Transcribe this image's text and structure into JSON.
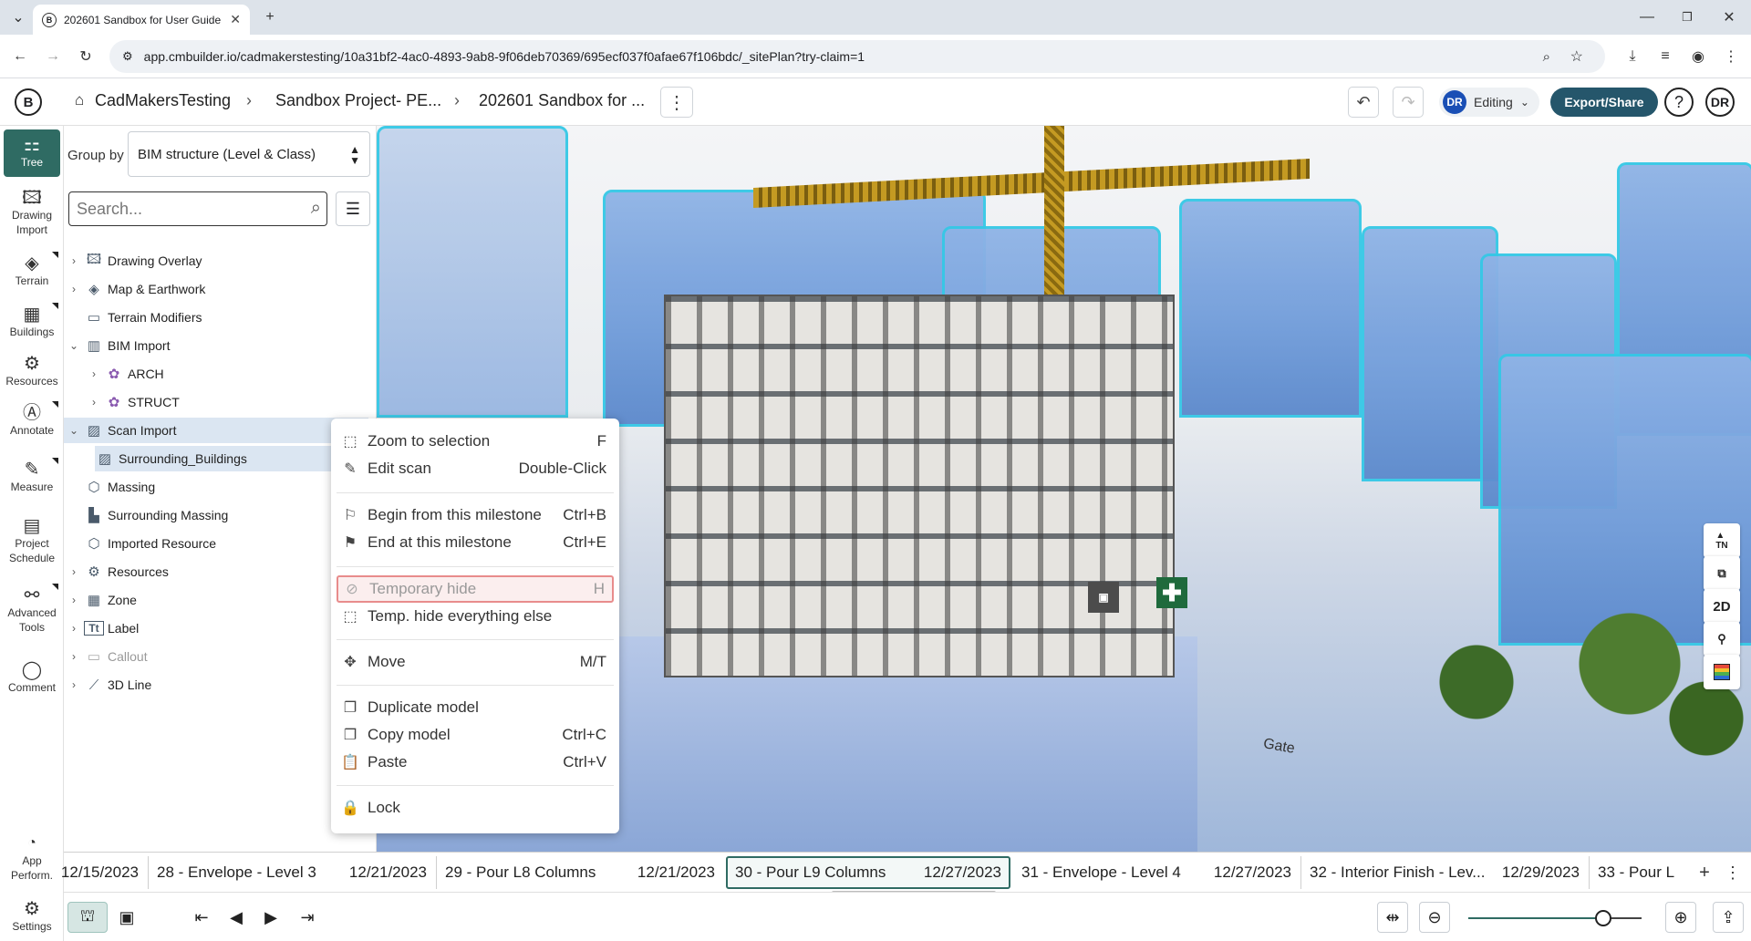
{
  "browser": {
    "tab_title": "202601 Sandbox for User Guide",
    "tab_favicon": "B",
    "url": "app.cmbuilder.io/cadmakerstesting/10a31bf2-4ac0-4893-9ab8-9f06deb70369/695ecf037f0afae67f106bdc/_sitePlan?try-claim=1"
  },
  "header": {
    "logo": "B",
    "breadcrumbs": [
      "CadMakersTesting",
      "Sandbox Project- PE...",
      "202601 Sandbox for ..."
    ],
    "mode": "Editing",
    "user_initials": "DR",
    "export_label": "Export/Share",
    "help": "?"
  },
  "rail": {
    "items": [
      {
        "label": "Tree",
        "icon": "tree-icon"
      },
      {
        "label": "Drawing Import",
        "icon": "drawing-import-icon"
      },
      {
        "label": "Terrain",
        "icon": "terrain-icon"
      },
      {
        "label": "Buildings",
        "icon": "buildings-icon"
      },
      {
        "label": "Resources",
        "icon": "resources-icon"
      },
      {
        "label": "Annotate",
        "icon": "annotate-icon"
      },
      {
        "label": "Measure",
        "icon": "measure-icon"
      },
      {
        "label": "Project Schedule",
        "icon": "schedule-icon"
      },
      {
        "label": "Advanced Tools",
        "icon": "advanced-tools-icon"
      },
      {
        "label": "Comment",
        "icon": "comment-icon"
      },
      {
        "label": "App Perform.",
        "icon": "performance-icon"
      },
      {
        "label": "Settings",
        "icon": "settings-icon"
      }
    ]
  },
  "tree": {
    "group_by_label": "Group by",
    "group_by_value": "BIM structure (Level & Class)",
    "search_placeholder": "Search...",
    "rows": [
      {
        "label": "Drawing Overlay"
      },
      {
        "label": "Map & Earthwork"
      },
      {
        "label": "Terrain Modifiers"
      },
      {
        "label": "BIM Import"
      },
      {
        "label": "ARCH"
      },
      {
        "label": "STRUCT"
      },
      {
        "label": "Scan Import"
      },
      {
        "label": "Surrounding_Buildings"
      },
      {
        "label": "Massing"
      },
      {
        "label": "Surrounding Massing"
      },
      {
        "label": "Imported Resource"
      },
      {
        "label": "Resources"
      },
      {
        "label": "Zone"
      },
      {
        "label": "Label"
      },
      {
        "label": "Callout"
      },
      {
        "label": "3D Line"
      }
    ]
  },
  "context_menu": {
    "items": [
      {
        "label": "Zoom to selection",
        "shortcut": "F"
      },
      {
        "label": "Edit scan",
        "shortcut": "Double-Click"
      },
      {
        "label": "Begin from this milestone",
        "shortcut": "Ctrl+B"
      },
      {
        "label": "End at this milestone",
        "shortcut": "Ctrl+E"
      },
      {
        "label": "Temporary hide",
        "shortcut": "H"
      },
      {
        "label": "Temp. hide everything else",
        "shortcut": ""
      },
      {
        "label": "Move",
        "shortcut": "M/T"
      },
      {
        "label": "Duplicate model",
        "shortcut": ""
      },
      {
        "label": "Copy model",
        "shortcut": "Ctrl+C"
      },
      {
        "label": "Paste",
        "shortcut": "Ctrl+V"
      },
      {
        "label": "Lock",
        "shortcut": ""
      }
    ]
  },
  "viewport": {
    "tools": [
      "TN",
      "layers",
      "2D",
      "pin",
      "legend"
    ],
    "gate_text": "Gate",
    "accent_color": "#35c8e6"
  },
  "timeline": {
    "first_date": "12/15/2023",
    "segments": [
      {
        "name": "28 - Envelope - Level 3",
        "date": "12/21/2023"
      },
      {
        "name": "29 - Pour L8 Columns",
        "date": "12/21/2023"
      },
      {
        "name": "30 - Pour L9 Columns",
        "date": "12/27/2023"
      },
      {
        "name": "31 - Envelope - Level 4",
        "date": "12/27/2023"
      },
      {
        "name": "32 - Interior Finish - Lev...",
        "date": "12/29/2023"
      },
      {
        "name": "33 - Pour L",
        "date": ""
      }
    ],
    "active_index": 2
  },
  "bottombar": {
    "zoom_level": 0.78
  },
  "colors": {
    "brand": "#2f6b63",
    "export_bg": "#25566b",
    "avatar": "#1a4fb5"
  }
}
